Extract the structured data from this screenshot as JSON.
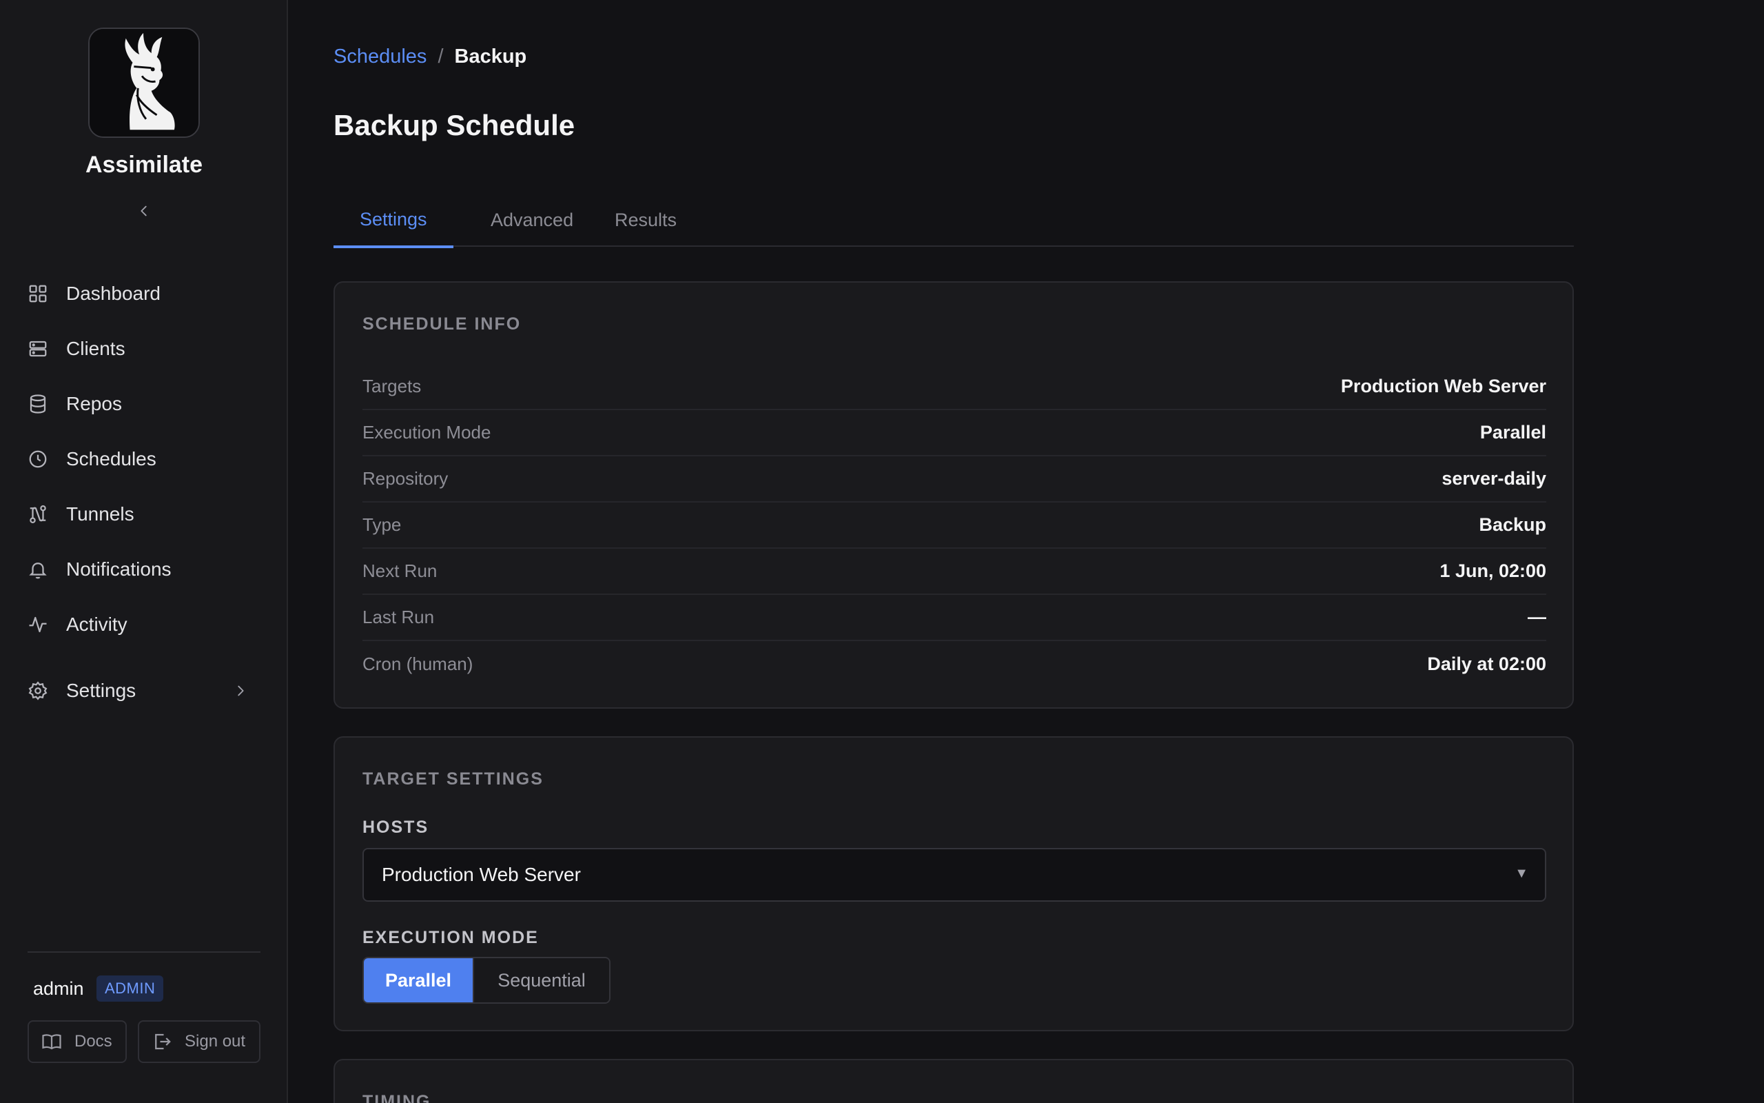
{
  "app": {
    "name": "Assimilate"
  },
  "sidebar": {
    "items": [
      {
        "label": "Dashboard",
        "icon": "grid-icon"
      },
      {
        "label": "Clients",
        "icon": "server-icon"
      },
      {
        "label": "Repos",
        "icon": "database-icon"
      },
      {
        "label": "Schedules",
        "icon": "clock-icon"
      },
      {
        "label": "Tunnels",
        "icon": "tunnel-icon"
      },
      {
        "label": "Notifications",
        "icon": "bell-icon"
      },
      {
        "label": "Activity",
        "icon": "activity-icon"
      },
      {
        "label": "Settings",
        "icon": "gear-icon"
      }
    ],
    "user": {
      "name": "admin",
      "role": "ADMIN"
    },
    "docs_label": "Docs",
    "signout_label": "Sign out"
  },
  "breadcrumb": {
    "parent": "Schedules",
    "separator": "/",
    "current": "Backup"
  },
  "page": {
    "title": "Backup Schedule"
  },
  "tabs": [
    {
      "label": "Settings",
      "active": true
    },
    {
      "label": "Advanced",
      "active": false
    },
    {
      "label": "Results",
      "active": false
    }
  ],
  "schedule_info": {
    "title": "SCHEDULE INFO",
    "rows": [
      {
        "key": "Targets",
        "value": "Production Web Server"
      },
      {
        "key": "Execution Mode",
        "value": "Parallel"
      },
      {
        "key": "Repository",
        "value": "server-daily"
      },
      {
        "key": "Type",
        "value": "Backup"
      },
      {
        "key": "Next Run",
        "value": "1 Jun, 02:00"
      },
      {
        "key": "Last Run",
        "value": "—"
      },
      {
        "key": "Cron (human)",
        "value": "Daily at 02:00"
      }
    ]
  },
  "target_settings": {
    "title": "TARGET SETTINGS",
    "hosts_label": "HOSTS",
    "hosts_value": "Production Web Server",
    "mode_label": "EXECUTION MODE",
    "mode_options": [
      "Parallel",
      "Sequential"
    ],
    "mode_selected": "Parallel"
  },
  "timing": {
    "title": "TIMING"
  },
  "colors": {
    "accent": "#5c8ef5",
    "background": "#121215",
    "card": "#1a1a1d"
  }
}
